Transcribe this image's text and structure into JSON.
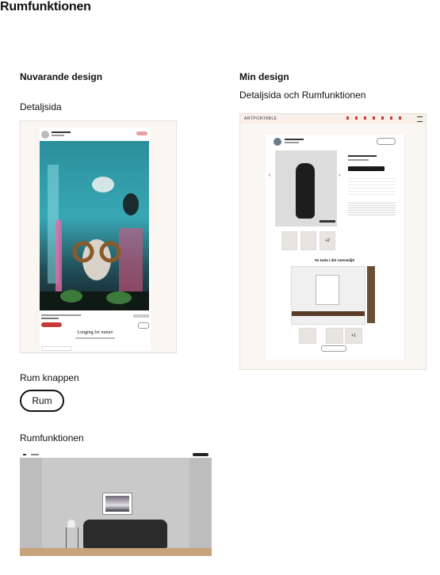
{
  "page": {
    "title": "Rumfunktionen"
  },
  "left": {
    "heading": "Nuvarande design",
    "detail_label": "Detaljsida",
    "artwork_title": "Longing for nature",
    "room_button_section": "Rum knappen",
    "room_button_label": "Rum",
    "room_function_label": "Rumfunktionen"
  },
  "right": {
    "heading": "Min design",
    "detail_label": "Detaljsida och Rumfunktionen",
    "brand": "ARTPORTABLE",
    "thumb_count": "+2",
    "room_title": "Se tavla i din rumsmiljö",
    "room_count": "+1"
  },
  "colors": {
    "accent": "#c83a3a",
    "frame_bg": "#faf6f2",
    "wall": "#c9c9c9"
  }
}
